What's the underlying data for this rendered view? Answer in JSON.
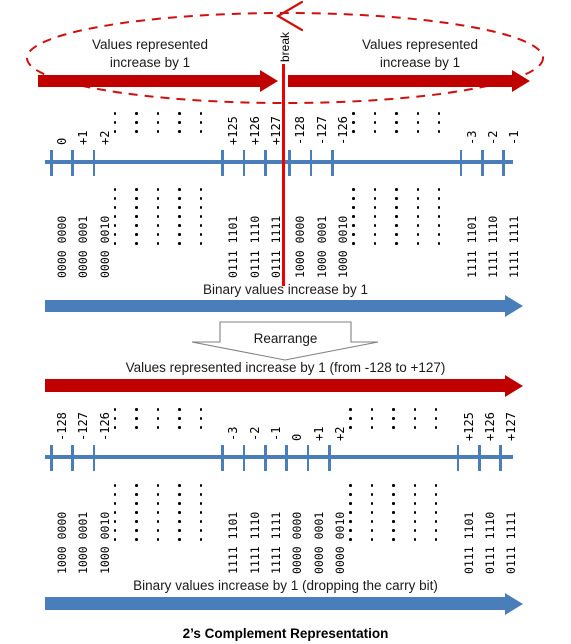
{
  "title": "2’s Complement Representation",
  "colors": {
    "red_arrow": "#C00000",
    "blue_arrow": "#4A7EBB",
    "break_line": "#ED0000",
    "dashed_ellipse": "#D01010",
    "axis": "#4A7EBB",
    "text": "#1a1a1a"
  },
  "top": {
    "break_label": "break",
    "left_caption_line1": "Values represented",
    "left_caption_line2": "increase by 1",
    "right_caption_line1": "Values represented",
    "right_caption_line2": "increase by 1",
    "binary_caption": "Binary values increase by 1",
    "columns": [
      {
        "value": "0",
        "binary": "0000 0000",
        "type": "num"
      },
      {
        "value": "+1",
        "binary": "0000 0001",
        "type": "num"
      },
      {
        "value": "+2",
        "binary": "0000 0010",
        "type": "num"
      },
      {
        "value": "",
        "binary": "",
        "type": "dots"
      },
      {
        "value": "",
        "binary": "",
        "type": "dots"
      },
      {
        "value": "",
        "binary": "",
        "type": "dots"
      },
      {
        "value": "",
        "binary": "",
        "type": "dots"
      },
      {
        "value": "",
        "binary": "",
        "type": "dots"
      },
      {
        "value": "+125",
        "binary": "0111 1101",
        "type": "num"
      },
      {
        "value": "+126",
        "binary": "0111 1110",
        "type": "num"
      },
      {
        "value": "+127",
        "binary": "0111 1111",
        "type": "num"
      },
      {
        "value": "-128",
        "binary": "1000 0000",
        "type": "num"
      },
      {
        "value": "-127",
        "binary": "1000 0001",
        "type": "num"
      },
      {
        "value": "-126",
        "binary": "1000 0010",
        "type": "num"
      },
      {
        "value": "",
        "binary": "",
        "type": "dots"
      },
      {
        "value": "",
        "binary": "",
        "type": "dots"
      },
      {
        "value": "",
        "binary": "",
        "type": "dots"
      },
      {
        "value": "",
        "binary": "",
        "type": "dots"
      },
      {
        "value": "",
        "binary": "",
        "type": "dots"
      },
      {
        "value": "-3",
        "binary": "1111 1101",
        "type": "num"
      },
      {
        "value": "-2",
        "binary": "1111 1110",
        "type": "num"
      },
      {
        "value": "-1",
        "binary": "1111 1111",
        "type": "num"
      }
    ],
    "break_after_index": 10
  },
  "middle": {
    "rearrange_label": "Rearrange"
  },
  "bottom": {
    "values_caption": "Values represented  increase by 1 (from -128 to +127)",
    "binary_caption": "Binary values increase by 1 (dropping  the carry bit)",
    "columns": [
      {
        "value": "-128",
        "binary": "1000 0000",
        "type": "num"
      },
      {
        "value": "-127",
        "binary": "1000 0001",
        "type": "num"
      },
      {
        "value": "-126",
        "binary": "1000 0010",
        "type": "num"
      },
      {
        "value": "",
        "binary": "",
        "type": "dots"
      },
      {
        "value": "",
        "binary": "",
        "type": "dots"
      },
      {
        "value": "",
        "binary": "",
        "type": "dots"
      },
      {
        "value": "",
        "binary": "",
        "type": "dots"
      },
      {
        "value": "",
        "binary": "",
        "type": "dots"
      },
      {
        "value": "-3",
        "binary": "1111 1101",
        "type": "num"
      },
      {
        "value": "-2",
        "binary": "1111 1110",
        "type": "num"
      },
      {
        "value": "-1",
        "binary": "1111 1111",
        "type": "num"
      },
      {
        "value": "0",
        "binary": "0000 0000",
        "type": "num"
      },
      {
        "value": "+1",
        "binary": "0000 0001",
        "type": "num"
      },
      {
        "value": "+2",
        "binary": "0000 0010",
        "type": "num"
      },
      {
        "value": "",
        "binary": "",
        "type": "dots"
      },
      {
        "value": "",
        "binary": "",
        "type": "dots"
      },
      {
        "value": "",
        "binary": "",
        "type": "dots"
      },
      {
        "value": "",
        "binary": "",
        "type": "dots"
      },
      {
        "value": "",
        "binary": "",
        "type": "dots"
      },
      {
        "value": "+125",
        "binary": "0111 1101",
        "type": "num"
      },
      {
        "value": "+126",
        "binary": "0111 1110",
        "type": "num"
      },
      {
        "value": "+127",
        "binary": "0111 1111",
        "type": "num"
      }
    ]
  }
}
